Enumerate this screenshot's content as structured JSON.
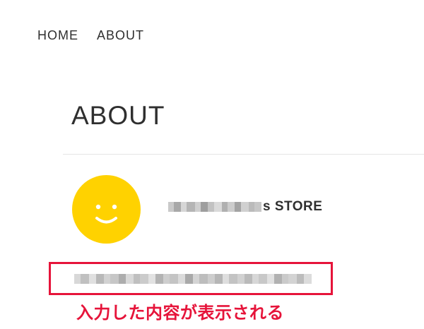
{
  "nav": {
    "items": [
      {
        "label": "HOME"
      },
      {
        "label": "ABOUT"
      }
    ]
  },
  "page": {
    "title": "ABOUT"
  },
  "profile": {
    "avatar_icon": "smiley-face-icon",
    "avatar_color": "#ffd200",
    "store_name_suffix": "s STORE"
  },
  "annotation": {
    "text": "入力した内容が表示される",
    "color": "#e6143a"
  }
}
